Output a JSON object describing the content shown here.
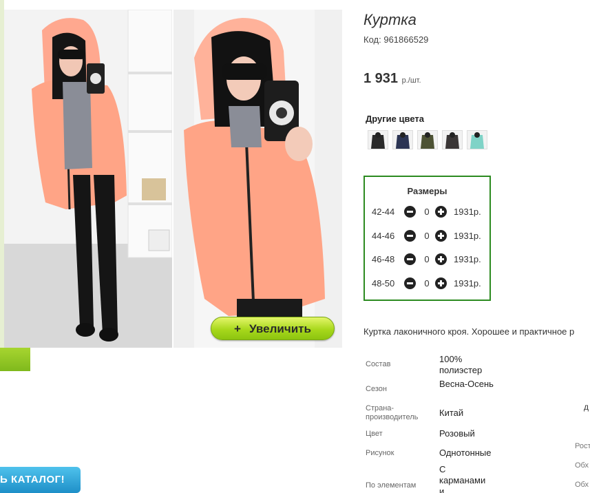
{
  "product": {
    "title": "Куртка",
    "code_label": "Код:",
    "code_value": "961866529",
    "price_value": "1 931",
    "price_unit": "р./шт."
  },
  "zoom_button": {
    "icon": "+",
    "label": "Увеличить"
  },
  "colors": {
    "heading": "Другие цвета",
    "swatches": [
      {
        "icon": "black-jacket-thumb",
        "color": "#2a2a2a"
      },
      {
        "icon": "navy-jacket-thumb",
        "color": "#2c3554"
      },
      {
        "icon": "olive-jacket-thumb",
        "color": "#4d5234"
      },
      {
        "icon": "dark-jacket-thumb",
        "color": "#3a3636"
      },
      {
        "icon": "mint-jacket-thumb",
        "color": "#7fd3c7"
      }
    ]
  },
  "sizes": {
    "heading": "Размеры",
    "rows": [
      {
        "label": "42-44",
        "qty": "0",
        "price": "1931р."
      },
      {
        "label": "44-46",
        "qty": "0",
        "price": "1931р."
      },
      {
        "label": "46-48",
        "qty": "0",
        "price": "1931р."
      },
      {
        "label": "48-50",
        "qty": "0",
        "price": "1931р."
      }
    ]
  },
  "description": "Куртка лаконичного кроя. Хорошее и практичное р",
  "specs": [
    {
      "key": "Состав",
      "value": "100% полиэстер"
    },
    {
      "key": "Сезон",
      "value": "Весна-Осень"
    },
    {
      "key": "Страна-производитель",
      "value": "Китай"
    },
    {
      "key": "Цвет",
      "value": "Розовый"
    },
    {
      "key": "Рисунок",
      "value": "Однотонные"
    },
    {
      "key": "По элементам",
      "value": "С карманами и"
    }
  ],
  "side_fragments": {
    "d": "д",
    "rost": "Рост",
    "obkh1": "Обх",
    "obkh2": "Обх"
  },
  "catalog_button": "Ь КАТАЛОГ!",
  "accent": {
    "green_border": "#2b8a1f",
    "lime_button": "#a8d81c",
    "blue_button": "#1e8fc8",
    "jacket_pink": "#ffa486"
  }
}
